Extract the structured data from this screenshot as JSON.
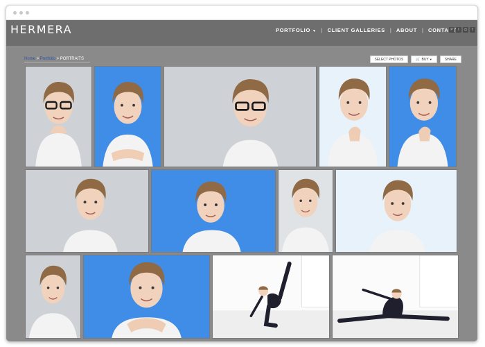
{
  "site": {
    "logo": "HERMERA"
  },
  "nav": {
    "items": [
      {
        "label": "PORTFOLIO",
        "has_dropdown": true
      },
      {
        "label": "CLIENT GALLERIES"
      },
      {
        "label": "ABOUT"
      },
      {
        "label": "CONTACT"
      }
    ],
    "separator": "|",
    "social_icons": [
      "pinterest-icon",
      "twitter-icon",
      "instagram-icon",
      "facebook-icon"
    ]
  },
  "breadcrumb": {
    "home": "Home",
    "portfolio": "Portfolio",
    "current": "PORTRAITS",
    "sep": " > "
  },
  "actions": {
    "select": "SELECT PHOTOS",
    "buy": "BUY",
    "share": "SHARE"
  },
  "colors": {
    "header": "#6e6e6e",
    "page_bg": "#8a8a8a",
    "link": "#2f55a8",
    "blue_backdrop": "#3f8de6"
  },
  "photos": [
    {
      "row": 1,
      "background": "grey",
      "subject": "boy-with-glasses"
    },
    {
      "row": 1,
      "background": "blue",
      "subject": "boy-hands-together"
    },
    {
      "row": 1,
      "background": "grey",
      "subject": "boy-with-glasses-closeup"
    },
    {
      "row": 1,
      "background": "lightblue",
      "subject": "boy-chin-on-hand"
    },
    {
      "row": 1,
      "background": "blue",
      "subject": "boy-chin-on-hand"
    },
    {
      "row": 2,
      "background": "grey",
      "subject": "boy-portrait"
    },
    {
      "row": 2,
      "background": "blue",
      "subject": "boy-head-tilt"
    },
    {
      "row": 2,
      "background": "lightgrey",
      "subject": "boy-portrait"
    },
    {
      "row": 2,
      "background": "lightblue",
      "subject": "boy-portrait"
    },
    {
      "row": 3,
      "background": "grey",
      "subject": "boy-portrait"
    },
    {
      "row": 3,
      "background": "blue",
      "subject": "boy-chin-on-hands"
    },
    {
      "row": 3,
      "background": "studio",
      "subject": "dancer-leg-raise"
    },
    {
      "row": 3,
      "background": "studio",
      "subject": "dancer-split"
    }
  ]
}
